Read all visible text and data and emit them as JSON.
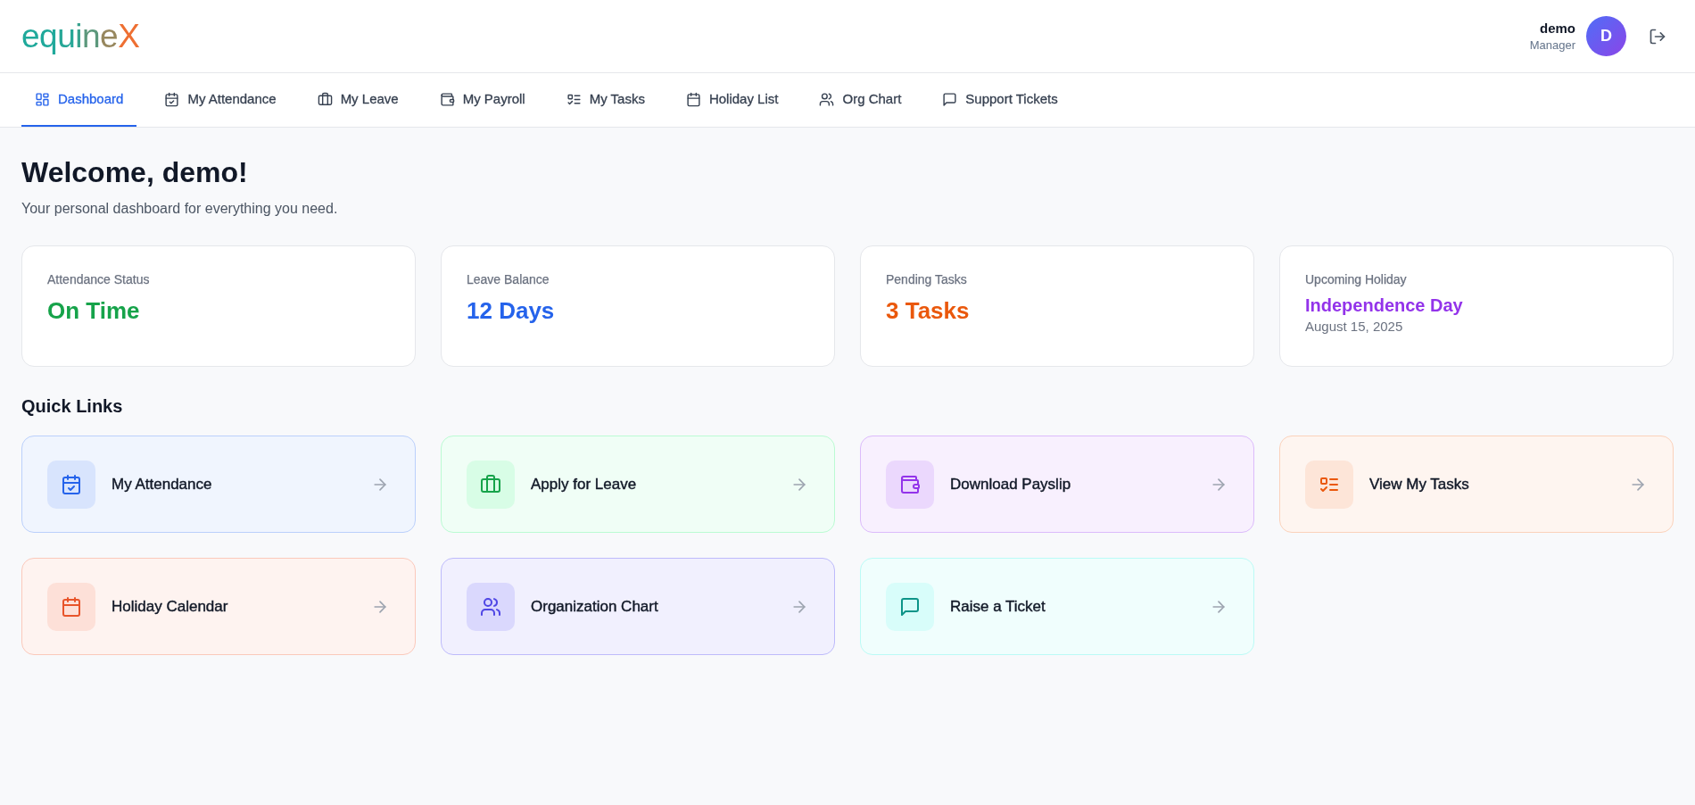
{
  "header": {
    "logo": "equineX",
    "user": {
      "name": "demo",
      "role": "Manager",
      "initial": "D"
    }
  },
  "tabs": [
    {
      "label": "Dashboard",
      "selected": true
    },
    {
      "label": "My Attendance",
      "selected": false
    },
    {
      "label": "My Leave",
      "selected": false
    },
    {
      "label": "My Payroll",
      "selected": false
    },
    {
      "label": "My Tasks",
      "selected": false
    },
    {
      "label": "Holiday List",
      "selected": false
    },
    {
      "label": "Org Chart",
      "selected": false
    },
    {
      "label": "Support Tickets",
      "selected": false
    }
  ],
  "welcome": {
    "title": "Welcome, demo!",
    "subtitle": "Your personal dashboard for everything you need."
  },
  "stats": [
    {
      "kind": "metric",
      "label": "Attendance Status",
      "value": "On Time",
      "color": "#16a34a"
    },
    {
      "kind": "metric",
      "label": "Leave Balance",
      "value": "12 Days",
      "color": "#2563eb"
    },
    {
      "kind": "metric",
      "label": "Pending Tasks",
      "value": "3 Tasks",
      "color": "#ea580c"
    },
    {
      "kind": "event",
      "label": "Upcoming Holiday",
      "value": "Independence Day",
      "detail": "August 15, 2025",
      "color": "#9333ea"
    }
  ],
  "quick_links": {
    "title": "Quick Links",
    "items": [
      {
        "label": "My Attendance",
        "color": "#2563eb"
      },
      {
        "label": "Apply for Leave",
        "color": "#16a34a"
      },
      {
        "label": "Download Payslip",
        "color": "#9333ea"
      },
      {
        "label": "View My Tasks",
        "color": "#ea580c"
      },
      {
        "label": "Holiday Calendar",
        "color": "#e8542a"
      },
      {
        "label": "Organization Chart",
        "color": "#4f46e5"
      },
      {
        "label": "Raise a Ticket",
        "color": "#0d9488"
      }
    ]
  }
}
